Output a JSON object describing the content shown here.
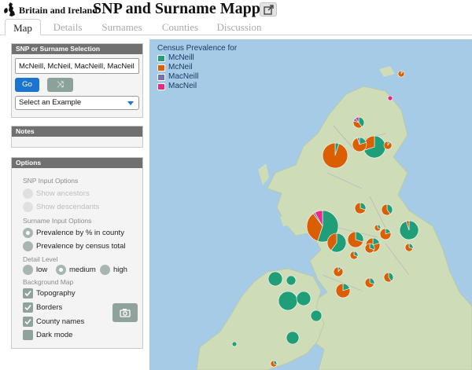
{
  "header": {
    "subtitle": "Britain and Ireland",
    "title": "SNP and Surname Mapper",
    "open_icon": "external-link-icon"
  },
  "tabs": [
    {
      "label": "Map",
      "active": true
    },
    {
      "label": "Details",
      "active": false
    },
    {
      "label": "Surnames",
      "active": false
    },
    {
      "label": "Counties",
      "active": false
    },
    {
      "label": "Discussion",
      "active": false
    }
  ],
  "search": {
    "heading": "SNP or Surname Selection",
    "input_value": "McNeill, McNeil, MacNeill, MacNeil",
    "go_label": "Go",
    "shuffle_icon": "shuffle-icon",
    "example_select": "Select an Example"
  },
  "notes": {
    "heading": "Notes"
  },
  "options": {
    "heading": "Options",
    "snp_label": "SNP Input Options",
    "show_ancestors": "Show ancestors",
    "show_descendants": "Show descendants",
    "surname_label": "Surname Input Options",
    "prevalence_pct": "Prevalence by % in county",
    "prevalence_total": "Prevalence by census total",
    "detail_label": "Detail Level",
    "detail_low": "low",
    "detail_medium": "medium",
    "detail_high": "high",
    "background_label": "Background Map",
    "topography": "Topography",
    "borders": "Borders",
    "county_names": "County names",
    "dark_mode": "Dark mode",
    "screenshot_icon": "camera-icon"
  },
  "legend": {
    "title": "Census Prevalence for",
    "items": [
      {
        "label": "McNeill",
        "color": "#1f9e77"
      },
      {
        "label": "McNeil",
        "color": "#d95f02"
      },
      {
        "label": "MacNeill",
        "color": "#7570b3"
      },
      {
        "label": "MacNeil",
        "color": "#e7298a"
      }
    ]
  },
  "colors": {
    "accent": "#1b75d0",
    "panel_header": "#707070",
    "sea": "#a6cbe6",
    "land": "#cfdcb8"
  }
}
